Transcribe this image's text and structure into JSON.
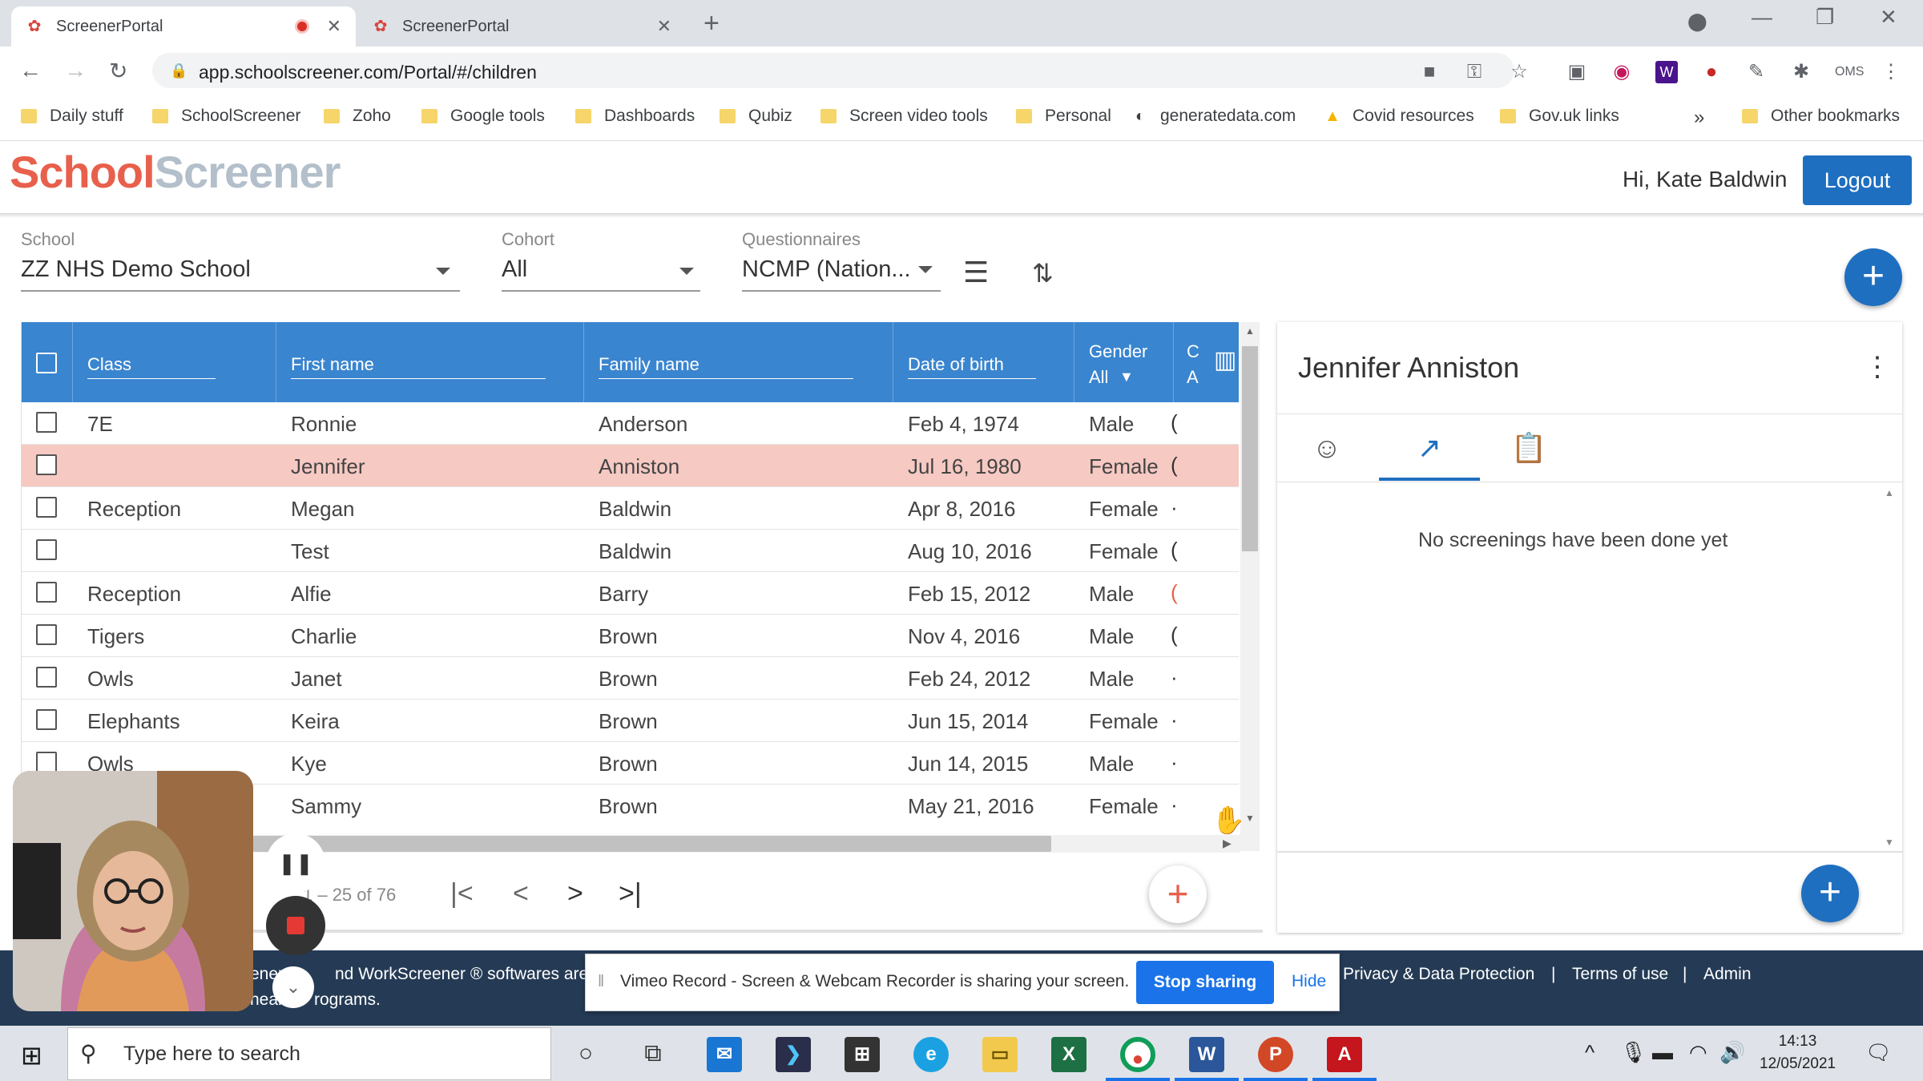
{
  "browser": {
    "tabs": [
      {
        "title": "ScreenerPortal",
        "active": true,
        "recording": true
      },
      {
        "title": "ScreenerPortal",
        "active": false,
        "recording": false
      }
    ],
    "url": "app.schoolscreener.com/Portal/#/children",
    "bookmarks": [
      "Daily stuff",
      "SchoolScreener",
      "Zoho",
      "Google tools",
      "Dashboards",
      "Qubiz",
      "Screen video tools",
      "Personal",
      "generatedata.com",
      "Covid resources",
      "Gov.uk links"
    ],
    "other_bookmarks": "Other bookmarks"
  },
  "app": {
    "logo_part1": "School",
    "logo_part2": "Screener",
    "greeting": "Hi, Kate Baldwin",
    "logout": "Logout"
  },
  "filters": {
    "school_label": "School",
    "school_value": "ZZ NHS Demo School",
    "cohort_label": "Cohort",
    "cohort_value": "All",
    "questionnaires_label": "Questionnaires",
    "questionnaires_value": "NCMP (Nation..."
  },
  "table": {
    "headers": {
      "class": "Class",
      "first_name": "First name",
      "family_name": "Family name",
      "dob": "Date of birth",
      "gender": "Gender",
      "gender_filter": "All",
      "cut1": "C",
      "cut2": "A"
    },
    "rows": [
      {
        "class": "7E",
        "first": "Ronnie",
        "family": "Anderson",
        "dob": "Feb 4, 1974",
        "gender": "Male",
        "mark": "("
      },
      {
        "class": "",
        "first": "Jennifer",
        "family": "Anniston",
        "dob": "Jul 16, 1980",
        "gender": "Female",
        "mark": "("
      },
      {
        "class": "Reception",
        "first": "Megan",
        "family": "Baldwin",
        "dob": "Apr 8, 2016",
        "gender": "Female",
        "mark": "·"
      },
      {
        "class": "",
        "first": "Test",
        "family": "Baldwin",
        "dob": "Aug 10, 2016",
        "gender": "Female",
        "mark": "("
      },
      {
        "class": "Reception",
        "first": "Alfie",
        "family": "Barry",
        "dob": "Feb 15, 2012",
        "gender": "Male",
        "mark": "("
      },
      {
        "class": "Tigers",
        "first": "Charlie",
        "family": "Brown",
        "dob": "Nov 4, 2016",
        "gender": "Male",
        "mark": "("
      },
      {
        "class": "Owls",
        "first": "Janet",
        "family": "Brown",
        "dob": "Feb 24, 2012",
        "gender": "Male",
        "mark": "·"
      },
      {
        "class": "Elephants",
        "first": "Keira",
        "family": "Brown",
        "dob": "Jun 15, 2014",
        "gender": "Female",
        "mark": "·"
      },
      {
        "class": "Owls",
        "first": "Kye",
        "family": "Brown",
        "dob": "Jun 14, 2015",
        "gender": "Male",
        "mark": "·"
      },
      {
        "class": "",
        "first": "Sammy",
        "family": "Brown",
        "dob": "May 21, 2016",
        "gender": "Female",
        "mark": "·"
      }
    ],
    "selected_row": 1,
    "pagination": "1 – 25 of 76"
  },
  "panel": {
    "title": "Jennifer Anniston",
    "empty_message": "No screenings have been done yet"
  },
  "footer": {
    "text_left": "ener",
    "text_mid": "nd WorkScreener ® softwares are us",
    "text_line2": "heal",
    "text_line2b": "rograms.",
    "privacy": "Privacy & Data Protection",
    "terms": "Terms of use",
    "admin": "Admin",
    "sep": "|"
  },
  "share_bar": {
    "message": "Vimeo Record - Screen & Webcam Recorder is sharing your screen.",
    "stop": "Stop sharing",
    "hide": "Hide"
  },
  "taskbar": {
    "search_placeholder": "Type here to search",
    "time": "14:13",
    "date": "12/05/2021"
  },
  "colors": {
    "brand_blue": "#1e6fc0",
    "header_blue": "#3a85cf",
    "selected_row": "#f6c9c3",
    "logo_orange": "#e8604c",
    "footer": "#253b55"
  }
}
